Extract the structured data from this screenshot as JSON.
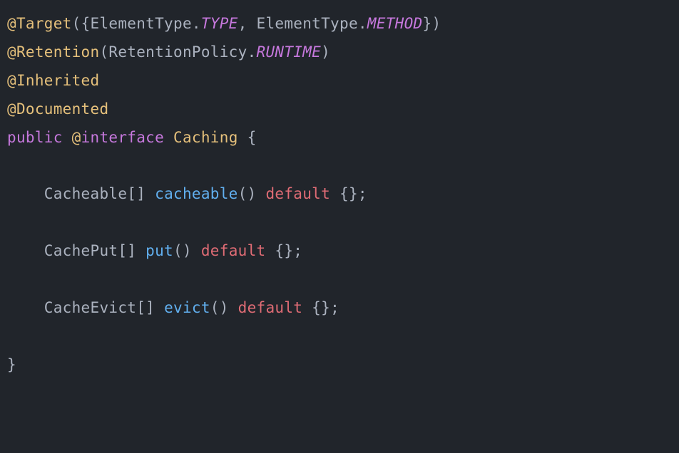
{
  "code": {
    "line1": {
      "at1": "@",
      "ann1": "Target",
      "open": "({",
      "t1a": "ElementType",
      "dot1": ".",
      "c1": "TYPE",
      "comma": ", ",
      "t1b": "ElementType",
      "dot2": ".",
      "c2": "METHOD",
      "close": "})"
    },
    "line2": {
      "at": "@",
      "ann": "Retention",
      "open": "(",
      "t": "RetentionPolicy",
      "dot": ".",
      "c": "RUNTIME",
      "close": ")"
    },
    "line3": {
      "at": "@",
      "ann": "Inherited"
    },
    "line4": {
      "at": "@",
      "ann": "Documented"
    },
    "line5": {
      "kw_public": "public",
      "sp": " ",
      "at": "@",
      "kw_interface": "interface",
      "sp2": " ",
      "name": "Caching",
      "brace": " {"
    },
    "line7": {
      "indent": "    ",
      "type": "Cacheable",
      "brackets": "[] ",
      "method": "cacheable",
      "parens": "() ",
      "default": "default",
      "rest": " {};"
    },
    "line9": {
      "indent": "    ",
      "type": "CachePut",
      "brackets": "[] ",
      "method": "put",
      "parens": "() ",
      "default": "default",
      "rest": " {};"
    },
    "line11": {
      "indent": "    ",
      "type": "CacheEvict",
      "brackets": "[] ",
      "method": "evict",
      "parens": "() ",
      "default": "default",
      "rest": " {};"
    },
    "line13": {
      "brace": "}"
    }
  }
}
